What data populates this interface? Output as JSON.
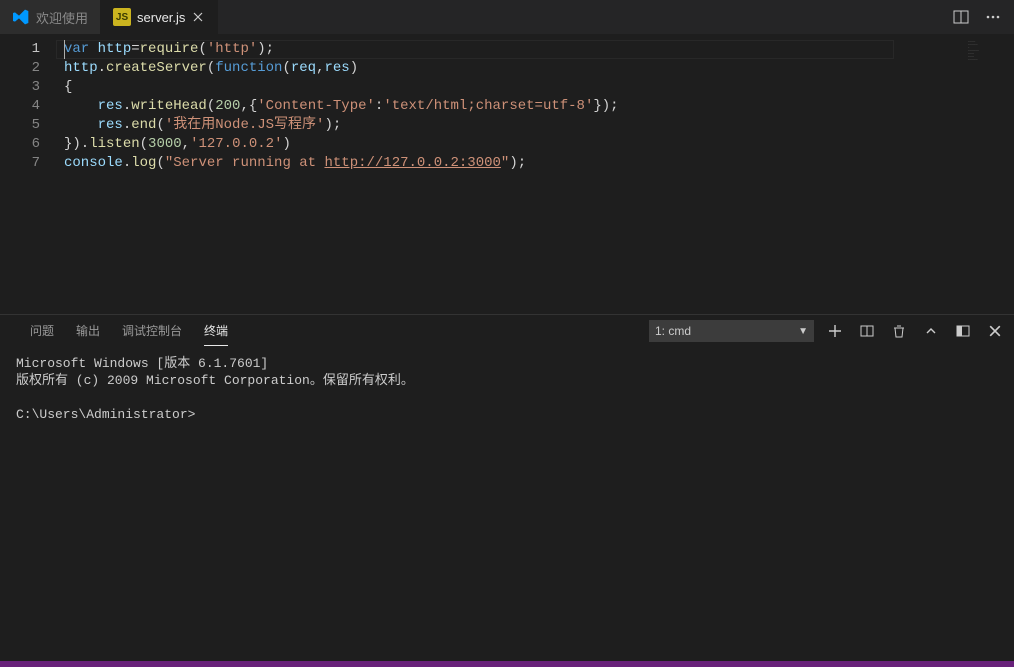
{
  "tabs": {
    "welcome": "欢迎使用",
    "file": "server.js"
  },
  "editor": {
    "lines": [
      "1",
      "2",
      "3",
      "4",
      "5",
      "6",
      "7"
    ],
    "code": {
      "l1": {
        "a": "var",
        "b": " http",
        "c": "=",
        "d": "require",
        "e": "(",
        "f": "'http'",
        "g": ");"
      },
      "l2": {
        "a": "http",
        "b": ".",
        "c": "createServer",
        "d": "(",
        "e": "function",
        "f": "(",
        "g": "req",
        "h": ",",
        "i": "res",
        "j": ")"
      },
      "l3": {
        "a": "{"
      },
      "l4": {
        "a": "    res",
        "b": ".",
        "c": "writeHead",
        "d": "(",
        "e": "200",
        "f": ",{",
        "g": "'Content-Type'",
        "h": ":",
        "i": "'text/html;charset=utf-8'",
        "j": "});"
      },
      "l5": {
        "a": "    res",
        "b": ".",
        "c": "end",
        "d": "(",
        "e": "'我在用Node.JS写程序'",
        "f": ");"
      },
      "l6": {
        "a": "}).",
        "b": "listen",
        "c": "(",
        "d": "3000",
        "e": ",",
        "f": "'127.0.0.2'",
        "g": ")"
      },
      "l7": {
        "a": "console",
        "b": ".",
        "c": "log",
        "d": "(",
        "e": "\"Server running at ",
        "f": "http://127.0.0.2:3000",
        "g": "\"",
        "h": ");"
      }
    }
  },
  "panel": {
    "tabs": {
      "problems": "问题",
      "output": "输出",
      "debug": "调试控制台",
      "terminal": "终端"
    },
    "select": "1: cmd"
  },
  "terminal": {
    "line1": "Microsoft Windows [版本 6.1.7601]",
    "line2": "版权所有 (c) 2009 Microsoft Corporation。保留所有权利。",
    "blank": "",
    "prompt": "C:\\Users\\Administrator>"
  },
  "icons": {
    "js": "JS"
  }
}
